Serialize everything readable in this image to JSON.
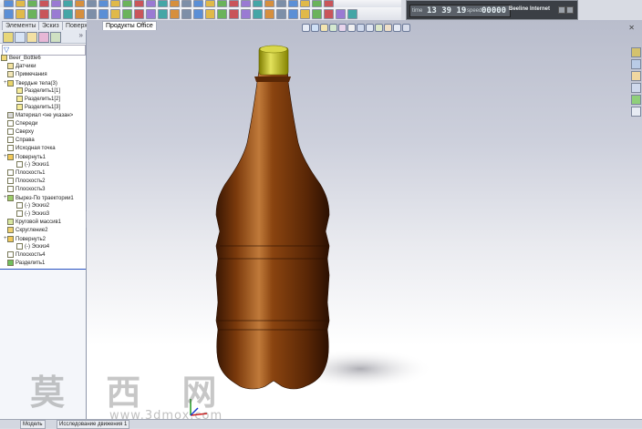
{
  "clock": {
    "time": "13 39 19",
    "speed_label": "speed",
    "speed_value": "00000",
    "prefix": "time",
    "title": "Beeline Internet"
  },
  "tabs": [
    {
      "label": "Элементы"
    },
    {
      "label": "Эскиз"
    },
    {
      "label": "Поверхности"
    },
    {
      "label": "Продукты Office"
    }
  ],
  "tree": {
    "root": "Beer_Bottle6",
    "items": [
      {
        "label": "Датчики",
        "indent": 1,
        "icon": "sensor-icon"
      },
      {
        "label": "Примечания",
        "indent": 1,
        "icon": "annotation-icon"
      },
      {
        "label": "Твердые тела(3)",
        "indent": 1,
        "icon": "solid-bodies-icon"
      },
      {
        "label": "Разделить1[1]",
        "indent": 2,
        "icon": "body-icon"
      },
      {
        "label": "Разделить1[2]",
        "indent": 2,
        "icon": "body-icon"
      },
      {
        "label": "Разделить1[3]",
        "indent": 2,
        "icon": "body-icon"
      },
      {
        "label": "Материал <не указан>",
        "indent": 1,
        "icon": "material-icon"
      },
      {
        "label": "Спереди",
        "indent": 1,
        "icon": "plane-icon"
      },
      {
        "label": "Сверху",
        "indent": 1,
        "icon": "plane-icon"
      },
      {
        "label": "Справа",
        "indent": 1,
        "icon": "plane-icon"
      },
      {
        "label": "Исходная точка",
        "indent": 1,
        "icon": "origin-icon"
      },
      {
        "label": "Повернуть1",
        "indent": 1,
        "icon": "revolve-icon"
      },
      {
        "label": "(-) Эскиз1",
        "indent": 2,
        "icon": "sketch-icon"
      },
      {
        "label": "Плоскость1",
        "indent": 1,
        "icon": "plane-icon"
      },
      {
        "label": "Плоскость2",
        "indent": 1,
        "icon": "plane-icon"
      },
      {
        "label": "Плоскость3",
        "indent": 1,
        "icon": "plane-icon"
      },
      {
        "label": "Вырез-По траектории1",
        "indent": 1,
        "icon": "sweep-cut-icon"
      },
      {
        "label": "(-) Эскиз2",
        "indent": 2,
        "icon": "sketch-icon"
      },
      {
        "label": "(-) Эскиз3",
        "indent": 2,
        "icon": "sketch-icon"
      },
      {
        "label": "Круговой массив1",
        "indent": 1,
        "icon": "pattern-icon"
      },
      {
        "label": "Скругление2",
        "indent": 1,
        "icon": "fillet-icon"
      },
      {
        "label": "Повернуть2",
        "indent": 1,
        "icon": "revolve-icon"
      },
      {
        "label": "(-) Эскиз4",
        "indent": 2,
        "icon": "sketch-icon"
      },
      {
        "label": "Плоскость4",
        "indent": 1,
        "icon": "plane-icon"
      },
      {
        "label": "Разделить1",
        "indent": 1,
        "icon": "split-icon"
      }
    ]
  },
  "status": {
    "model_tab": "Модель",
    "motion_tab": "Исследование движения 1"
  },
  "watermark": {
    "chars": "莫 西 网",
    "url": "www.3dmox.com"
  },
  "colors": {
    "bottle": "#6a3208",
    "cap": "#b7b800",
    "accent": "#2a54c2"
  }
}
